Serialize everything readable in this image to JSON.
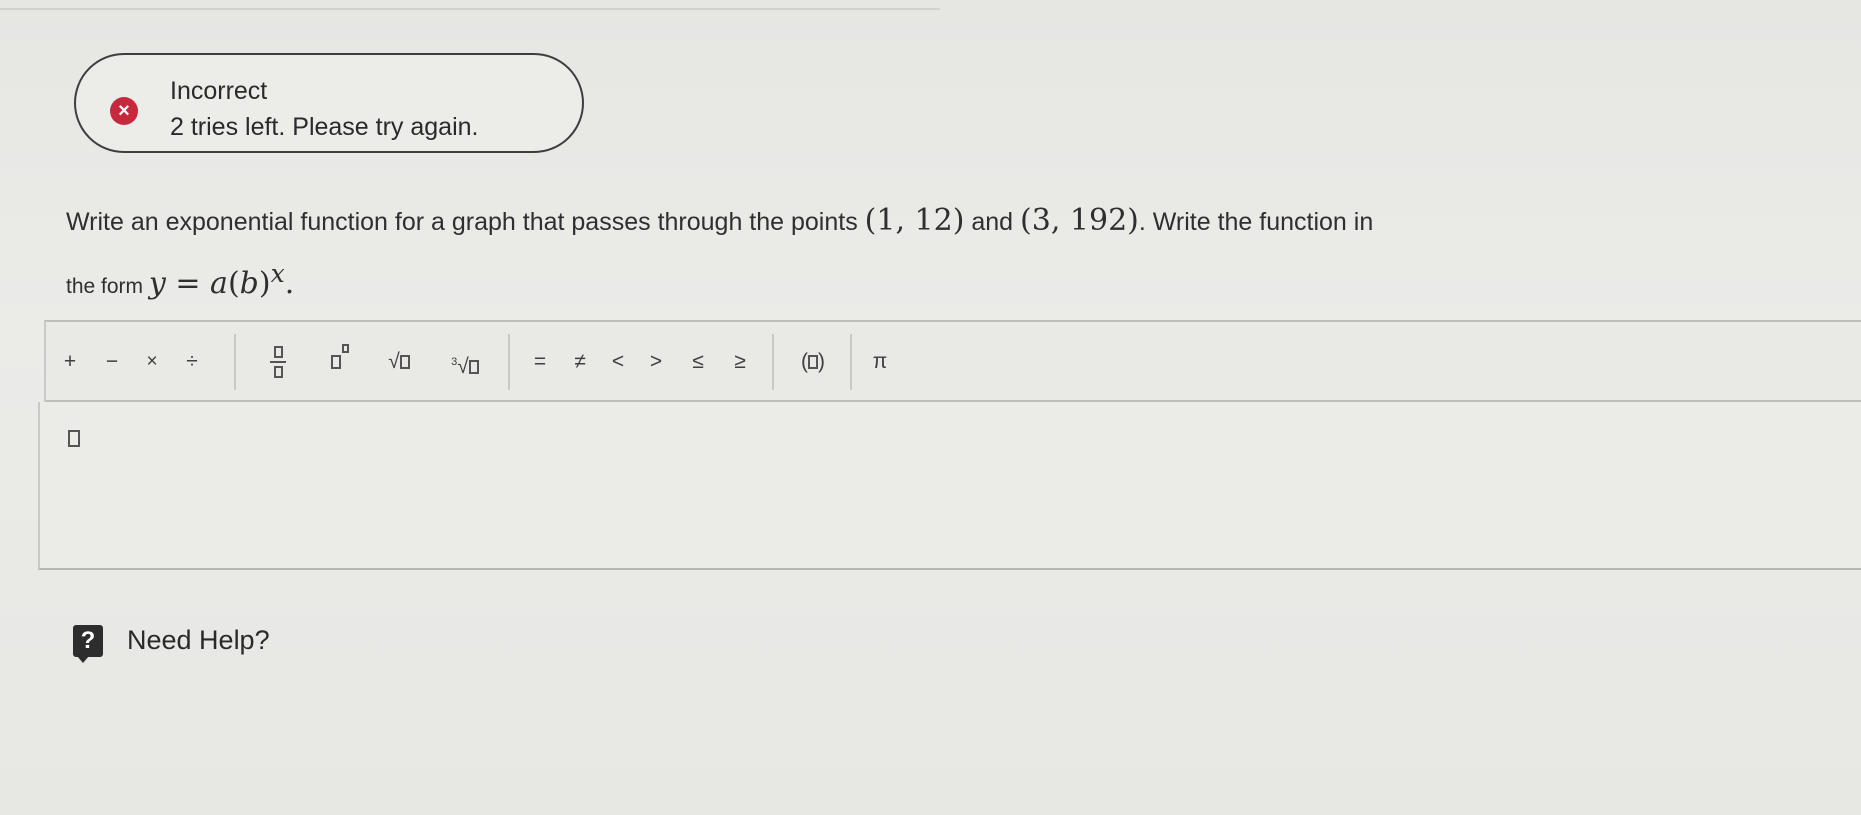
{
  "feedback": {
    "icon": "x-icon",
    "title": "Incorrect",
    "message": "2 tries left. Please try again.",
    "status_color": "#c8283c"
  },
  "question": {
    "text_before": "Write an exponential function for a graph that passes through the points ",
    "point1": "(1, 12)",
    "text_and": " and ",
    "point2": "(3,  192)",
    "text_after": ". Write the function in",
    "form_label": "the form ",
    "form_y": "y",
    "form_eq": " = ",
    "form_a": "a",
    "form_lparen": "(",
    "form_b": "b",
    "form_rparen": ")",
    "form_x": "x",
    "form_end": "."
  },
  "toolbar": {
    "plus": "+",
    "minus": "−",
    "times": "×",
    "divide": "÷",
    "equals": "=",
    "not_equals": "≠",
    "less": "<",
    "greater": ">",
    "leq": "≤",
    "geq": "≥",
    "paren_open": "(",
    "paren_close": ")",
    "pi": "π",
    "sqrt": "√",
    "cube_root_index": "3"
  },
  "help": {
    "icon": "question-icon",
    "label": "Need Help?"
  }
}
